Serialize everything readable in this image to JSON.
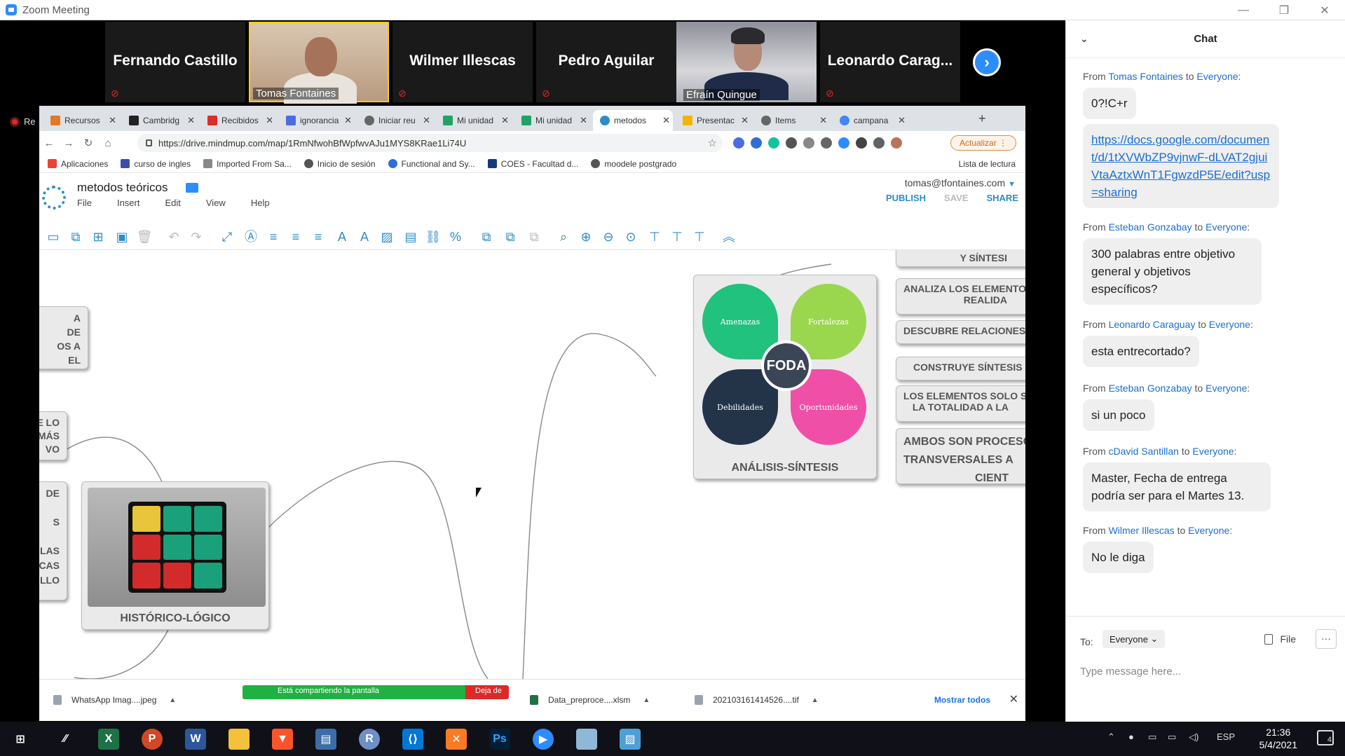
{
  "window": {
    "title": "Zoom Meeting",
    "minimize": "—",
    "restore": "❐",
    "close": "✕"
  },
  "participants": [
    {
      "name": "Fernando Castillo"
    },
    {
      "name": "Tomas Fontaines",
      "video": true
    },
    {
      "name": "Wilmer Illescas"
    },
    {
      "name": "Pedro Aguilar"
    },
    {
      "name": "Efraín Quingue",
      "video": true
    },
    {
      "name": "Leonardo Carag..."
    }
  ],
  "recording": {
    "label": "Re"
  },
  "browser": {
    "tabs": [
      {
        "label": "Recursos",
        "color": "#e07a2a"
      },
      {
        "label": "Cambridg",
        "color": "#222222"
      },
      {
        "label": "Recibidos",
        "color": "#d93025"
      },
      {
        "label": "ignorancia",
        "color": "#4a6ee0"
      },
      {
        "label": "Iniciar reu",
        "color": "#666666"
      },
      {
        "label": "Mi unidad",
        "color": "#1fa463"
      },
      {
        "label": "Mi unidad",
        "color": "#1fa463"
      },
      {
        "label": "metodos",
        "color": "#2d8cc8",
        "active": true
      },
      {
        "label": "Presentac",
        "color": "#f4b400"
      },
      {
        "label": "Items",
        "color": "#666666"
      },
      {
        "label": "campana",
        "color": "#4285f4"
      }
    ],
    "url": "https://drive.mindmup.com/map/1RmNfwohBfWpfwvAJu1MYS8KRae1Li74U",
    "update_label": "Actualizar",
    "bookmarks": [
      "Aplicaciones",
      "curso de ingles",
      "Imported From Sa...",
      "Inicio de sesión",
      "Functional and Sy...",
      "COES - Facultad d...",
      "moodele postgrado"
    ],
    "reading_list": "Lista de lectura"
  },
  "mindmup": {
    "doc_title": "metodos teóricos",
    "menu": [
      "File",
      "Insert",
      "Edit",
      "View",
      "Help"
    ],
    "user": "tomas@tfontaines.com",
    "actions": {
      "publish": "PUBLISH",
      "save": "SAVE",
      "share": "SHARE"
    },
    "nodes": {
      "historico": "HISTÓRICO-LÓGICO",
      "analisis": "ANÁLISIS-SÍNTESIS",
      "foda_center": "FODA",
      "foda": [
        "Amenazas",
        "Fortalezas",
        "Debilidades",
        "Oportunidades"
      ]
    },
    "right_nodes": [
      "Y SÍNTESI",
      "ANALIZA LOS ELEMENTOS",
      "REALIDA",
      "DESCUBRE RELACIONES E",
      "CONSTRUYE SÍNTESIS DE",
      "LOS ELEMENTOS SOLO SE I",
      "LA TOTALIDAD A LA",
      "AMBOS SON PROCESO",
      "TRANSVERSALES A",
      "CIENT"
    ],
    "left_nodes": [
      "A",
      "DE",
      "OS A",
      "EL",
      "E LO",
      "MÁS",
      "VO",
      "DE",
      "S",
      "LAS",
      "CAS",
      "LLO"
    ]
  },
  "downloads": {
    "items": [
      "WhatsApp Imag....jpeg",
      "Data_preproce....xlsm",
      "202103161414526....tif"
    ],
    "show_all": "Mostrar todos",
    "share_text": "Está compartiendo la pantalla",
    "stop_text": "Deja de"
  },
  "chat": {
    "title": "Chat",
    "messages": [
      {
        "from": "Tomas Fontaines",
        "to": "Everyone",
        "text": "0?!C+r"
      },
      {
        "text": "https://docs.google.com/document/d/1tXVWbZP9vjnwF-dLVAT2gjuiVtaAztxWnT1FgwzdP5E/edit?usp=sharing",
        "link": true
      },
      {
        "from": "Esteban Gonzabay",
        "to": "Everyone",
        "text": "300 palabras entre objetivo general y objetivos específicos?"
      },
      {
        "from": "Leonardo Caraguay",
        "to": "Everyone",
        "text": "esta entrecortado?"
      },
      {
        "from": "Esteban Gonzabay",
        "to": "Everyone",
        "text": "si un poco"
      },
      {
        "from": "cDavid Santillan",
        "to": "Everyone",
        "text": "Master, Fecha de entrega podría ser para el Martes 13."
      },
      {
        "from": "Wilmer Illescas",
        "to": "Everyone",
        "text": "No le diga"
      }
    ],
    "from_word": "From",
    "to_word": "to",
    "recipient_label": "To:",
    "recipient": "Everyone",
    "file_label": "File",
    "more_label": "···",
    "input_placeholder": "Type message here..."
  },
  "taskbar": {
    "language": "ESP",
    "time": "21:36",
    "date": "5/4/2021",
    "notifications": "4"
  }
}
